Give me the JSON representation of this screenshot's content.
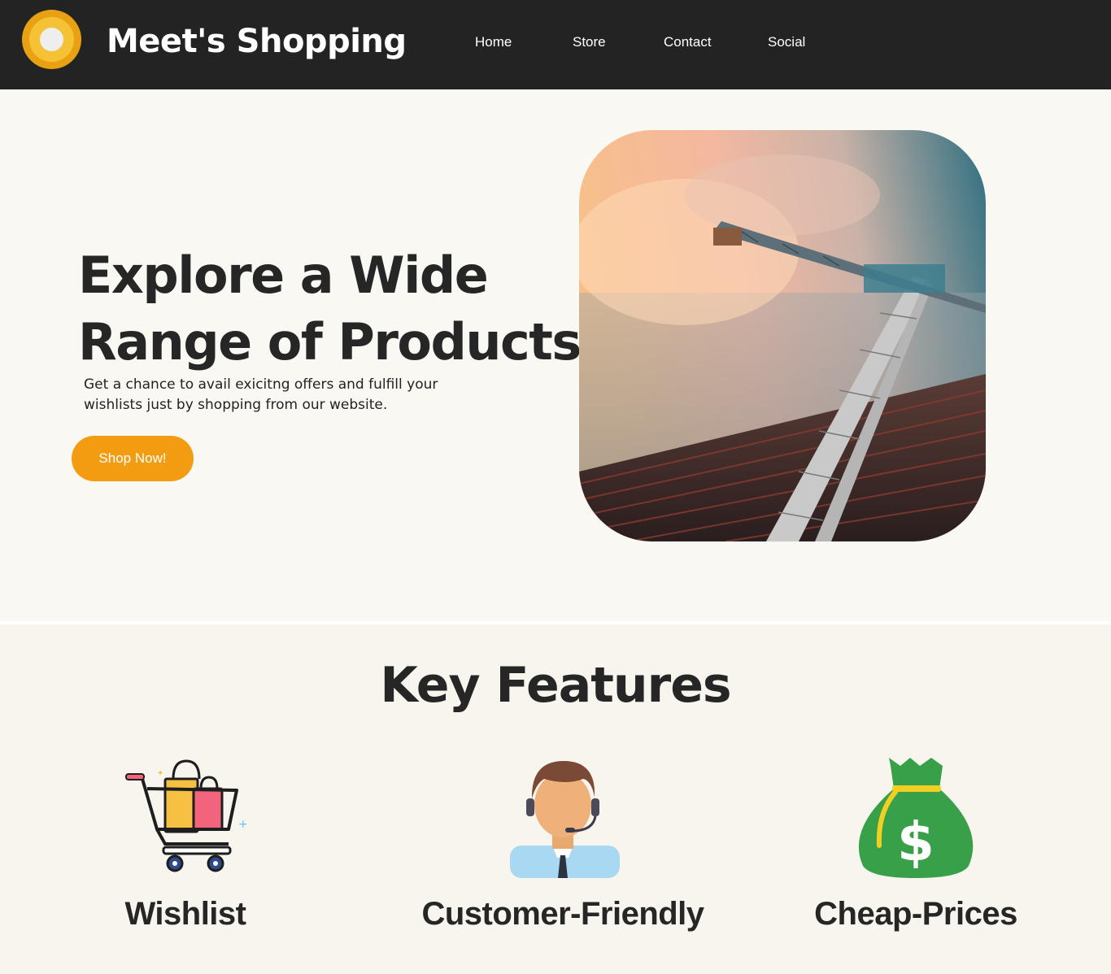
{
  "header": {
    "brand": "Meet's Shopping",
    "nav": [
      "Home",
      "Store",
      "Contact",
      "Social"
    ]
  },
  "hero": {
    "title": "Explore a Wide Range of Products",
    "subtitle": "Get a chance to avail exicitng offers and fulfill your wishlists just by shopping from our website.",
    "cta": "Shop Now!"
  },
  "features": {
    "title": "Key Features",
    "items": [
      {
        "label": "Wishlist",
        "icon": "shopping-cart-icon"
      },
      {
        "label": "Customer-Friendly",
        "icon": "support-agent-icon"
      },
      {
        "label": "Cheap-Prices",
        "icon": "money-bag-icon"
      }
    ]
  },
  "colors": {
    "header_bg": "#232323",
    "accent": "#f39c12",
    "page_bg": "#faf8f3"
  }
}
